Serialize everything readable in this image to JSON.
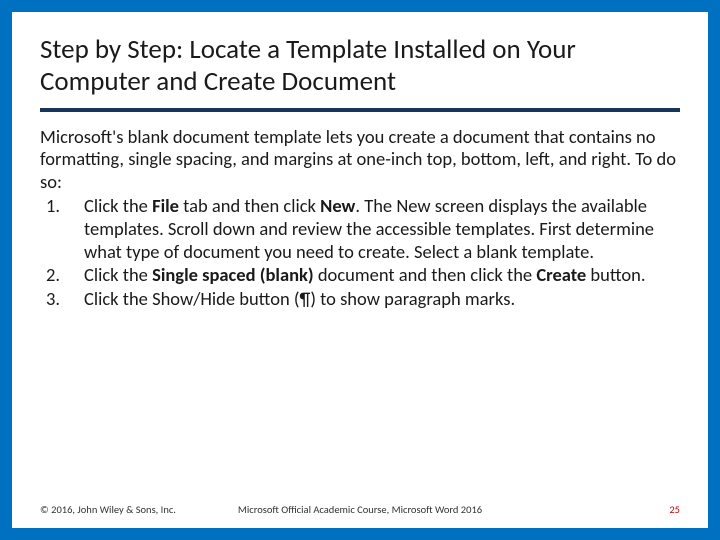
{
  "title": "Step by Step: Locate a Template Installed on Your Computer and Create Document",
  "intro": "Microsoft's blank document template lets you create a document that contains no formatting, single spacing, and margins at one-inch top, bottom, left, and right. To do so:",
  "steps": {
    "s1a": "Click the ",
    "s1b": "File",
    "s1c": " tab and then click ",
    "s1d": "New",
    "s1e": ". The New screen displays the available templates. Scroll down and review the accessible templates. First determine what type of document you need to create. Select a blank template.",
    "s2a": "Click the ",
    "s2b": "Single spaced (blank)",
    "s2c": " document and then click the ",
    "s2d": "Create",
    "s2e": " button.",
    "s3": "Click the Show/Hide button (¶) to show paragraph marks."
  },
  "footer": {
    "copyright": "© 2016, John Wiley & Sons, Inc.",
    "course": "Microsoft Official Academic Course, Microsoft Word 2016",
    "page": "25"
  }
}
